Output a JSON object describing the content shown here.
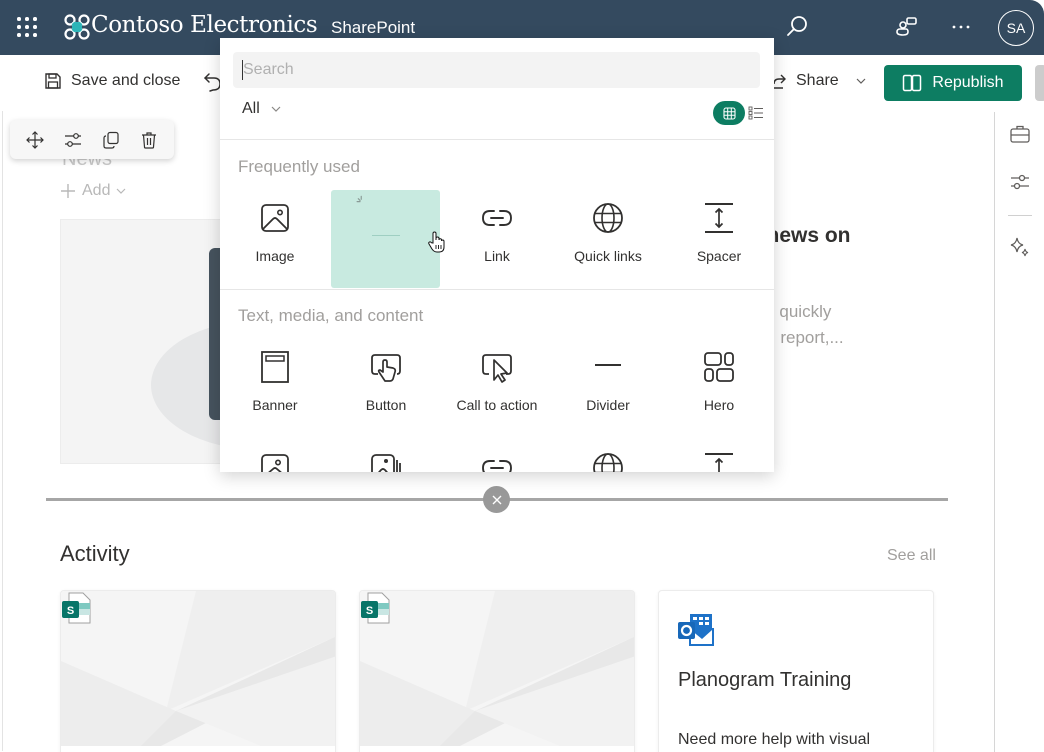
{
  "suitebar": {
    "brand": "Contoso Electronics",
    "app_name": "SharePoint",
    "avatar_initials": "SA",
    "colors": {
      "background": "#344a5f",
      "logo_accent": "#2bb5b8"
    }
  },
  "commandbar": {
    "save_close_label": "Save and close",
    "share_label": "Share",
    "republish_label": "Republish",
    "colors": {
      "primary": "#0d7d62"
    }
  },
  "canvas": {
    "section_title_faded": "News",
    "add_label": "Add",
    "news_heading": "d with news on",
    "news_desc_line1": "be able to quickly",
    "news_desc_line2": "pdate, trip report,..."
  },
  "toolbox": {
    "search_placeholder": "Search",
    "filter_label": "All",
    "view_modes": [
      "grid",
      "list"
    ],
    "active_view": "grid",
    "sections": [
      {
        "title": "Frequently used",
        "items": [
          {
            "label": "Image",
            "icon": "image-icon"
          },
          {
            "label": "",
            "icon": "loading-spinner",
            "state": "hover-loading"
          },
          {
            "label": "Link",
            "icon": "link-icon"
          },
          {
            "label": "Quick links",
            "icon": "globe-icon"
          },
          {
            "label": "Spacer",
            "icon": "spacer-icon"
          }
        ]
      },
      {
        "title": "Text, media, and content",
        "items": [
          {
            "label": "Banner",
            "icon": "banner-icon"
          },
          {
            "label": "Button",
            "icon": "button-icon"
          },
          {
            "label": "Call to action",
            "icon": "call-to-action-icon"
          },
          {
            "label": "Divider",
            "icon": "divider-icon"
          },
          {
            "label": "Hero",
            "icon": "hero-icon"
          }
        ]
      }
    ],
    "partial_row_icons": [
      "image-icon",
      "image-gallery-icon",
      "link-icon",
      "globe-icon",
      "spacer-icon"
    ]
  },
  "activity": {
    "title": "Activity",
    "see_all_label": "See all",
    "cards": [
      {
        "type": "sharepoint-page",
        "icon": "sharepoint-file-icon"
      },
      {
        "type": "sharepoint-page",
        "icon": "sharepoint-file-icon"
      },
      {
        "type": "outlook",
        "icon": "outlook-calendar-icon",
        "title": "Planogram Training",
        "description": "Need more help with visual"
      }
    ]
  }
}
